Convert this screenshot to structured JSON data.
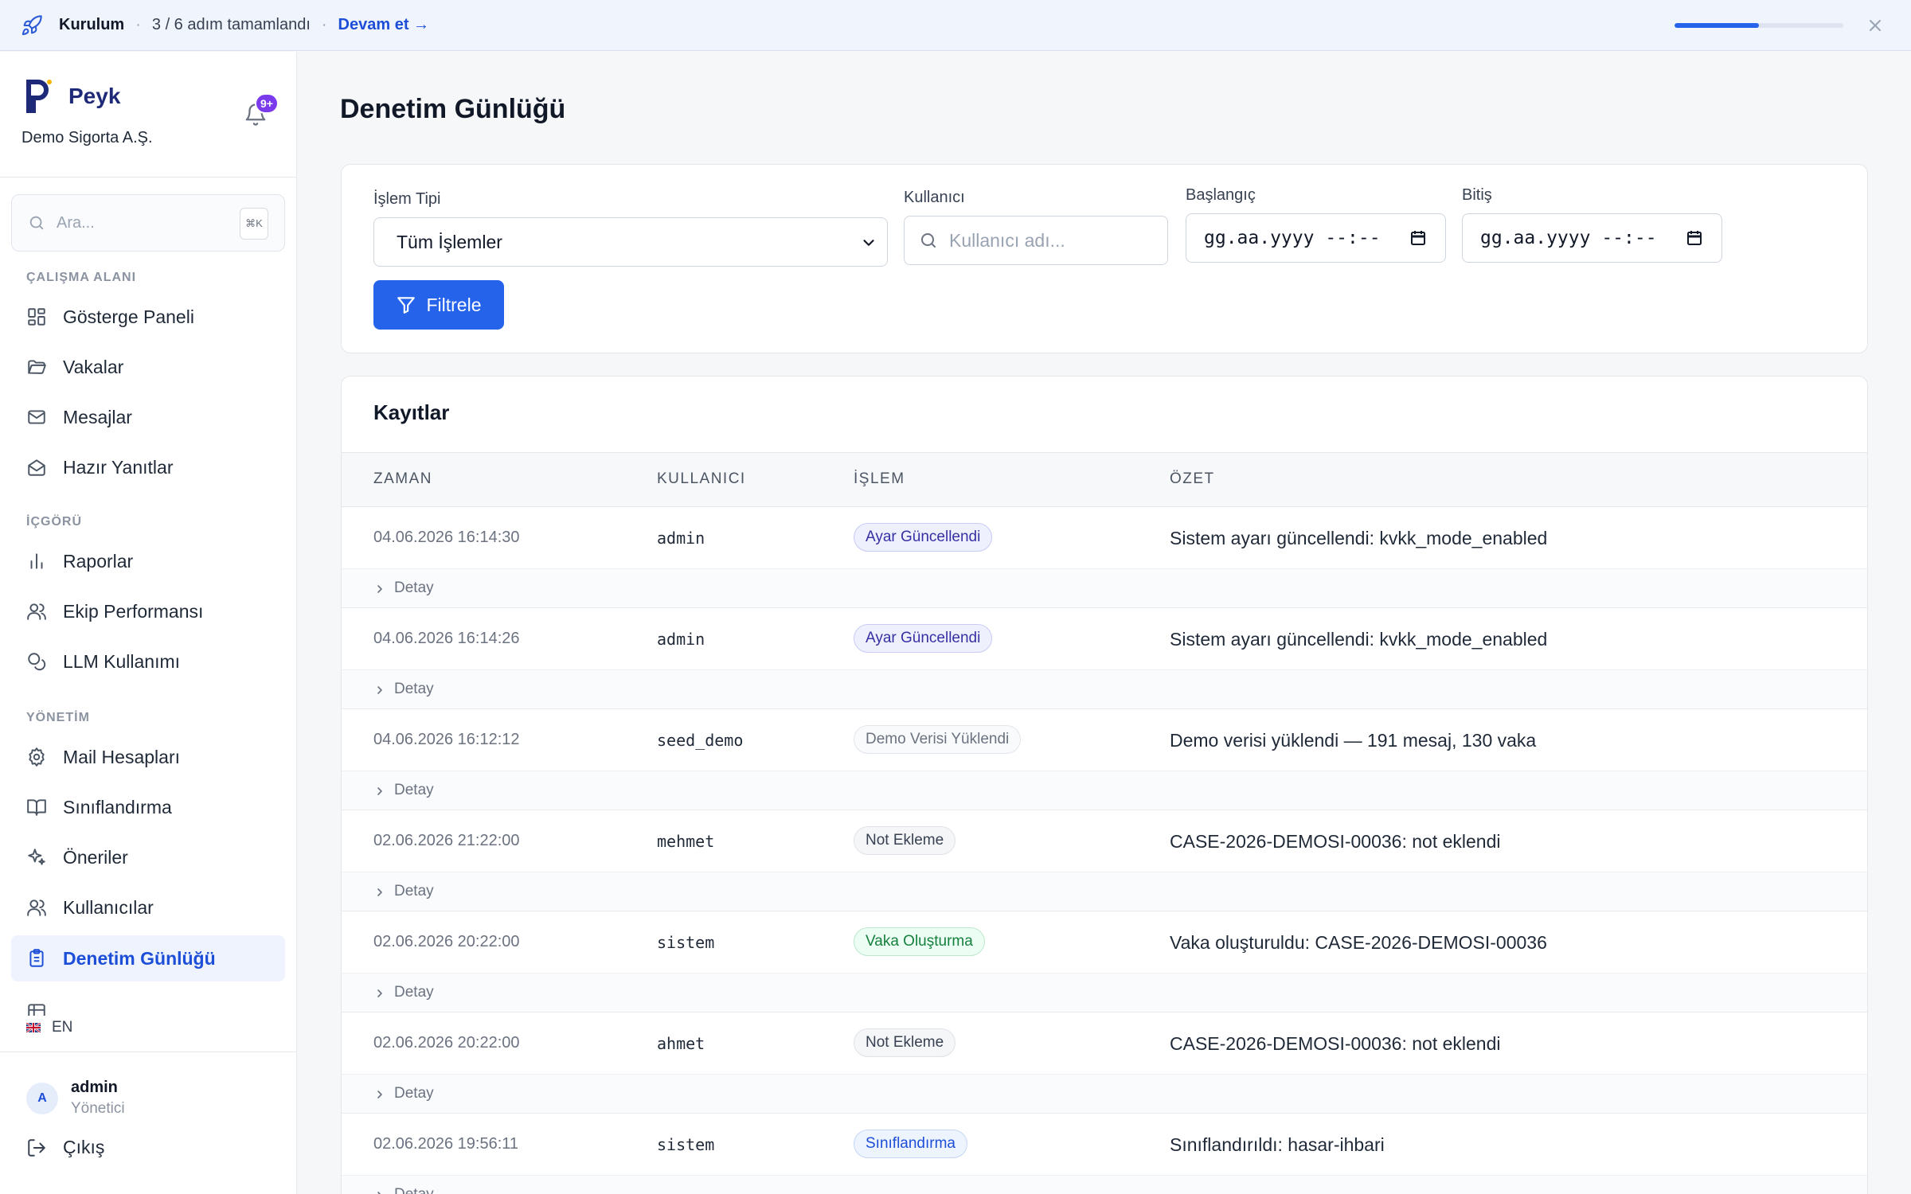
{
  "banner": {
    "title": "Kurulum",
    "status": "3 / 6 adım tamamlandı",
    "link": "Devam et →",
    "progress": 0.5
  },
  "sidebar": {
    "brand": "Peyk",
    "org": "Demo Sigorta A.Ş.",
    "notif_badge": "9+",
    "search_placeholder": "Ara...",
    "search_shortcut": "⌘K",
    "sections": {
      "workspace": "ÇALIŞMA ALANI",
      "insight": "İÇGÖRÜ",
      "admin": "YÖNETİM"
    },
    "items": [
      {
        "label": "Gösterge Paneli",
        "icon": "dashboard-icon"
      },
      {
        "label": "Vakalar",
        "icon": "folder-icon"
      },
      {
        "label": "Mesajlar",
        "icon": "mail-icon"
      },
      {
        "label": "Hazır Yanıtlar",
        "icon": "mail-open-icon"
      },
      {
        "label": "Raporlar",
        "icon": "bar-chart-icon"
      },
      {
        "label": "Ekip Performansı",
        "icon": "users-icon"
      },
      {
        "label": "LLM Kullanımı",
        "icon": "coins-icon"
      },
      {
        "label": "Mail Hesapları",
        "icon": "gear-icon"
      },
      {
        "label": "Sınıflandırma",
        "icon": "book-icon"
      },
      {
        "label": "Öneriler",
        "icon": "sparkle-icon"
      },
      {
        "label": "Kullanıcılar",
        "icon": "users-icon"
      },
      {
        "label": "Denetim Günlüğü",
        "icon": "clipboard-icon"
      }
    ],
    "language": "EN",
    "user": {
      "name": "admin",
      "role": "Yönetici",
      "initial": "A"
    },
    "logout": "Çıkış"
  },
  "main": {
    "title": "Denetim Günlüğü",
    "filters": {
      "type_label": "İşlem Tipi",
      "type_value": "Tüm İşlemler",
      "user_label": "Kullanıcı",
      "user_placeholder": "Kullanıcı adı...",
      "start_label": "Başlangıç",
      "start_value": "gg.aa.yyyy --:--",
      "end_label": "Bitiş",
      "end_value": "gg.aa.yyyy --:--",
      "button": "Filtrele"
    },
    "records": {
      "title": "Kayıtlar",
      "columns": [
        "ZAMAN",
        "KULLANICI",
        "İŞLEM",
        "ÖZET"
      ],
      "detail_label": "Detay",
      "rows": [
        {
          "time": "04.06.2026 16:14:30",
          "user": "admin",
          "action": "Ayar Güncellendi",
          "summary": "Sistem ayarı güncellendi: kvkk_mode_enabled",
          "chip_bg": "#eef0fd",
          "chip_fg": "#3730a3",
          "chip_border": "#c7cbf5"
        },
        {
          "time": "04.06.2026 16:14:26",
          "user": "admin",
          "action": "Ayar Güncellendi",
          "summary": "Sistem ayarı güncellendi: kvkk_mode_enabled",
          "chip_bg": "#eef0fd",
          "chip_fg": "#3730a3",
          "chip_border": "#c7cbf5"
        },
        {
          "time": "04.06.2026 16:12:12",
          "user": "seed_demo",
          "action": "Demo Verisi Yüklendi",
          "summary": "Demo verisi yüklendi — 191 mesaj, 130 vaka",
          "chip_bg": "#f9fafb",
          "chip_fg": "#6b7280",
          "chip_border": "#e2e5ea"
        },
        {
          "time": "02.06.2026 21:22:00",
          "user": "mehmet",
          "action": "Not Ekleme",
          "summary": "CASE-2026-DEMOSI-00036: not eklendi",
          "chip_bg": "#f5f6f8",
          "chip_fg": "#374151",
          "chip_border": "#dfe2e7"
        },
        {
          "time": "02.06.2026 20:22:00",
          "user": "sistem",
          "action": "Vaka Oluşturma",
          "summary": "Vaka oluşturuldu: CASE-2026-DEMOSI-00036",
          "chip_bg": "#ecfdf3",
          "chip_fg": "#15803d",
          "chip_border": "#bbe8cc"
        },
        {
          "time": "02.06.2026 20:22:00",
          "user": "ahmet",
          "action": "Not Ekleme",
          "summary": "CASE-2026-DEMOSI-00036: not eklendi",
          "chip_bg": "#f5f6f8",
          "chip_fg": "#374151",
          "chip_border": "#dfe2e7"
        },
        {
          "time": "02.06.2026 19:56:11",
          "user": "sistem",
          "action": "Sınıflandırma",
          "summary": "Sınıflandırıldı: hasar-ihbari",
          "chip_bg": "#eef4fe",
          "chip_fg": "#1d4ed8",
          "chip_border": "#c4d6f8"
        }
      ]
    }
  }
}
